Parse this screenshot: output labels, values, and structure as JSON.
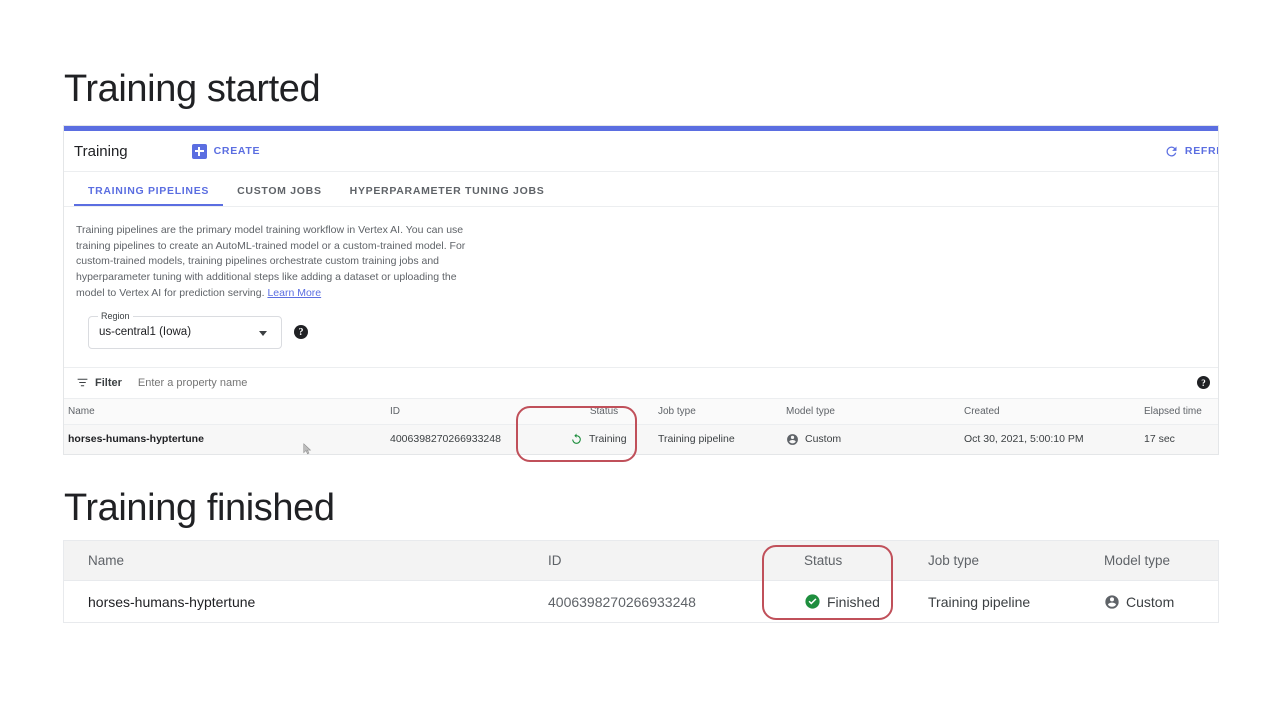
{
  "slide": {
    "heading_started": "Training started",
    "heading_finished": "Training finished"
  },
  "console": {
    "title": "Training",
    "create_label": "CREATE",
    "refresh_label": "REFRESH",
    "tabs": [
      {
        "label": "TRAINING PIPELINES",
        "active": true
      },
      {
        "label": "CUSTOM JOBS",
        "active": false
      },
      {
        "label": "HYPERPARAMETER TUNING JOBS",
        "active": false
      }
    ],
    "description": "Training pipelines are the primary model training workflow in Vertex AI. You can use training pipelines to create an AutoML-trained model or a custom-trained model. For custom-trained models, training pipelines orchestrate custom training jobs and hyperparameter tuning with additional steps like adding a dataset or uploading the model to Vertex AI for prediction serving. ",
    "description_link": "Learn More",
    "region": {
      "legend": "Region",
      "value": "us-central1 (Iowa)",
      "help": "?"
    },
    "filter": {
      "label": "Filter",
      "placeholder": "Enter a property name",
      "value": "",
      "help": "?"
    }
  },
  "table_started": {
    "headers": [
      "Name",
      "ID",
      "Status",
      "Job type",
      "Model type",
      "Created",
      "Elapsed time"
    ],
    "row": {
      "name": "horses-humans-hyptertune",
      "id": "4006398270266933248",
      "status": "Training",
      "job_type": "Training pipeline",
      "model_type": "Custom",
      "created": "Oct 30, 2021, 5:00:10 PM",
      "elapsed": "17 sec"
    }
  },
  "table_finished": {
    "headers": [
      "Name",
      "ID",
      "Status",
      "Job type",
      "Model type"
    ],
    "row": {
      "name": "horses-humans-hyptertune",
      "id": "4006398270266933248",
      "status": "Finished",
      "job_type": "Training pipeline",
      "model_type": "Custom"
    }
  },
  "colors": {
    "accent_blue": "#5b6ee1",
    "status_green": "#1e8e3e",
    "annotation_red": "#c0505a"
  }
}
